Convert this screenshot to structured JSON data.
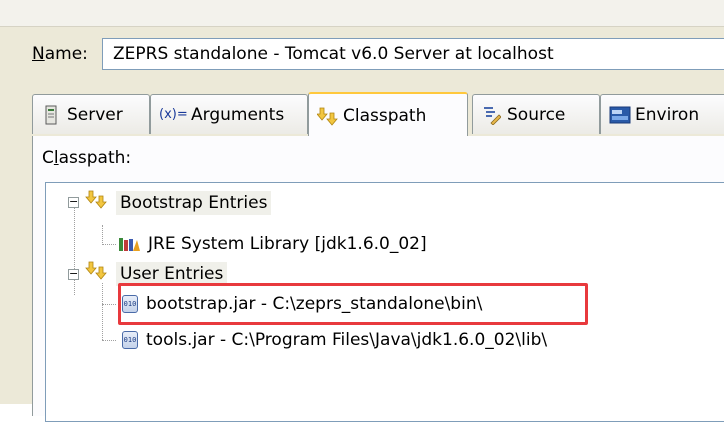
{
  "name_field": {
    "label_mnemonic": "N",
    "label_rest": "ame:",
    "value": "ZEPRS standalone - Tomcat v6.0 Server at localhost"
  },
  "tabs": [
    {
      "label": "Server",
      "icon": "server-icon"
    },
    {
      "label": "Arguments",
      "icon": "arguments-icon",
      "icon_text": "(x)="
    },
    {
      "label": "Classpath",
      "icon": "classpath-icon"
    },
    {
      "label": "Source",
      "icon": "source-icon"
    },
    {
      "label": "Environ",
      "icon": "environment-icon"
    }
  ],
  "classpath": {
    "label_pre": "C",
    "label_mnemonic": "l",
    "label_rest": "asspath:",
    "tree": {
      "bootstrap_entries": "Bootstrap Entries",
      "jre_library": "JRE System Library [jdk1.6.0_02]",
      "user_entries": "User Entries",
      "bootstrap_jar": "bootstrap.jar - C:\\zeprs_standalone\\bin\\",
      "tools_jar": "tools.jar - C:\\Program Files\\Java\\jdk1.6.0_02\\lib\\"
    }
  },
  "colors": {
    "highlight_box": "#e8393d",
    "active_tab_accent": "#ffc83c"
  }
}
